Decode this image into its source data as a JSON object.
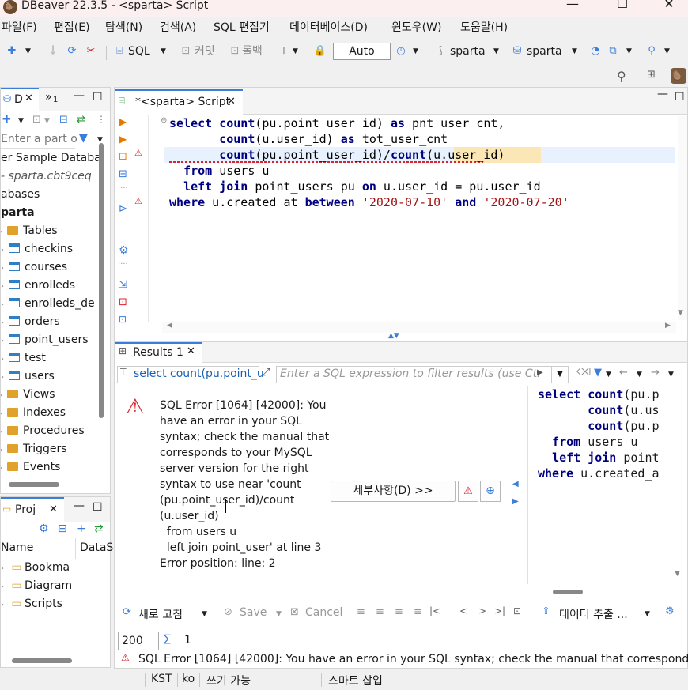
{
  "window": {
    "title": "DBeaver 22.3.5 - <sparta> Script",
    "minimize": "—",
    "maximize": "☐",
    "close": "✕"
  },
  "menu": [
    "파일(F)",
    "편집(E)",
    "탐색(N)",
    "검색(A)",
    "SQL 편집기",
    "데이터베이스(D)",
    "윈도우(W)",
    "도움말(H)"
  ],
  "toolbar": {
    "sql_label": "SQL",
    "commit_label": "커밋",
    "rollback_label": "롤백",
    "auto_value": "Auto",
    "connection": "sparta",
    "schema": "sparta"
  },
  "left_panel": {
    "tab_label": "D",
    "tab2_label": "»",
    "tab2_count": "1",
    "filter_placeholder": "Enter a part o",
    "tree": [
      {
        "label": "er Sample Databa",
        "type": "root"
      },
      {
        "label": "- sparta.cbt9ceq",
        "type": "host"
      },
      {
        "label": "abases",
        "type": "group"
      },
      {
        "label": "parta",
        "type": "db"
      },
      {
        "label": "Tables",
        "type": "folder"
      },
      {
        "label": "checkins",
        "type": "table"
      },
      {
        "label": "courses",
        "type": "table"
      },
      {
        "label": "enrolleds",
        "type": "table"
      },
      {
        "label": "enrolleds_de",
        "type": "table"
      },
      {
        "label": "orders",
        "type": "table"
      },
      {
        "label": "point_users",
        "type": "table"
      },
      {
        "label": "test",
        "type": "table"
      },
      {
        "label": "users",
        "type": "table"
      },
      {
        "label": "Views",
        "type": "folder"
      },
      {
        "label": "Indexes",
        "type": "folder"
      },
      {
        "label": "Procedures",
        "type": "folder"
      },
      {
        "label": "Triggers",
        "type": "folder"
      },
      {
        "label": "Events",
        "type": "folder"
      }
    ]
  },
  "projects_panel": {
    "tab_label": "Proj",
    "col_name": "Name",
    "col_datasource": "DataS",
    "items": [
      "Bookma",
      "Diagram",
      "Scripts"
    ]
  },
  "editor": {
    "tab_label": "*<sparta> Script",
    "lines": [
      [
        {
          "t": "select",
          "k": 1
        },
        {
          "t": " "
        },
        {
          "t": "count",
          "k": 1
        },
        {
          "t": "(pu.point_user_id) "
        },
        {
          "t": "as",
          "k": 1
        },
        {
          "t": " pnt_user_cnt,"
        }
      ],
      [
        {
          "t": "       "
        },
        {
          "t": "count",
          "k": 1
        },
        {
          "t": "(u.user_id) "
        },
        {
          "t": "as",
          "k": 1
        },
        {
          "t": " tot_user_cnt"
        }
      ],
      [
        {
          "t": "       "
        },
        {
          "t": "count",
          "k": 1
        },
        {
          "t": "(pu.point_user_id)/"
        },
        {
          "t": "count",
          "k": 1
        },
        {
          "t": "(u.user_id)"
        }
      ],
      [
        {
          "t": "  "
        },
        {
          "t": "from",
          "k": 1
        },
        {
          "t": " users u"
        }
      ],
      [
        {
          "t": "  "
        },
        {
          "t": "left",
          "k": 1
        },
        {
          "t": " "
        },
        {
          "t": "join",
          "k": 1
        },
        {
          "t": " point_users pu "
        },
        {
          "t": "on",
          "k": 1
        },
        {
          "t": " u.user_id = pu.user_id"
        }
      ],
      [
        {
          "t": "where",
          "k": 1
        },
        {
          "t": " u.created_at "
        },
        {
          "t": "between",
          "k": 1
        },
        {
          "t": " "
        },
        {
          "t": "'2020-07-10'",
          "s": 1
        },
        {
          "t": " "
        },
        {
          "t": "and",
          "k": 1
        },
        {
          "t": " "
        },
        {
          "t": "'2020-07-20'",
          "s": 1
        }
      ]
    ]
  },
  "results": {
    "tab_label": "Results 1",
    "query_label": "select count(pu.point_u",
    "filter_placeholder": "Enter a SQL expression to filter results (use Ctrl",
    "error_text": "SQL Error [1064] [42000]: You\nhave an error in your SQL\nsyntax; check the manual that\ncorresponds to your MySQL\nserver version for the right\nsyntax to use near 'count\n(pu.point_user_id)/count\n(u.user_id)\n  from users u\n  left join point_user' at line 3\nError position: line: 2",
    "details_button": "세부사항(D) >>",
    "side_code": [
      [
        {
          "t": "select",
          "k": 1
        },
        {
          "t": " "
        },
        {
          "t": "count",
          "k": 1
        },
        {
          "t": "(pu.p"
        }
      ],
      [
        {
          "t": "       "
        },
        {
          "t": "count",
          "k": 1
        },
        {
          "t": "(u.us"
        }
      ],
      [
        {
          "t": "       "
        },
        {
          "t": "count",
          "k": 1
        },
        {
          "t": "(pu.p"
        }
      ],
      [
        {
          "t": "  "
        },
        {
          "t": "from",
          "k": 1
        },
        {
          "t": " users u"
        }
      ],
      [
        {
          "t": "  "
        },
        {
          "t": "left",
          "k": 1
        },
        {
          "t": " "
        },
        {
          "t": "join",
          "k": 1
        },
        {
          "t": " point"
        }
      ],
      [
        {
          "t": "where",
          "k": 1
        },
        {
          "t": " u.created_a"
        }
      ]
    ],
    "refresh_label": "새로 고침",
    "save_label": "Save",
    "cancel_label": "Cancel",
    "export_label": "데이터 추출 ...",
    "fetch_size": "200",
    "row_count": "1",
    "bottom_error": "SQL Error [1064] [42000]: You have an error in your SQL syntax; check the manual that corresponds to"
  },
  "status": {
    "timezone": "KST",
    "locale": "ko",
    "mode": "쓰기 가능",
    "insert": "스마트 삽입"
  },
  "colors": {
    "keyword": "#00007f",
    "string": "#a31515",
    "accent": "#3b7dd8",
    "error": "#d9232e"
  }
}
